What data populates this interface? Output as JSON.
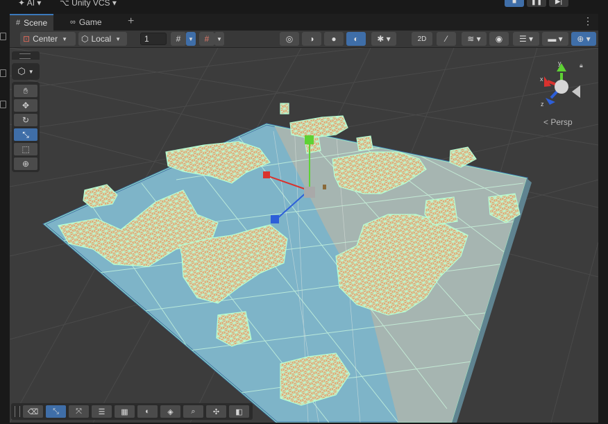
{
  "menubar": {
    "ai_label": "AI",
    "vcs_label": "Unity VCS"
  },
  "play_controls": {
    "play_icon": "stop-icon",
    "pause_icon": "pause-icon",
    "step_icon": "step-icon"
  },
  "tabs": [
    {
      "label": "Scene",
      "icon": "grid-icon",
      "active": true
    },
    {
      "label": "Game",
      "icon": "gamepad-icon",
      "active": false
    }
  ],
  "toolbar": {
    "pivot_mode": "Center",
    "pivot_rotation": "Local",
    "snap_increment": "1"
  },
  "tools": [
    {
      "name": "view-tool",
      "icon": "hand-icon",
      "active": false
    },
    {
      "name": "move-tool",
      "icon": "move-icon",
      "active": false
    },
    {
      "name": "rotate-tool",
      "icon": "rotate-icon",
      "active": false
    },
    {
      "name": "scale-tool",
      "icon": "scale-icon",
      "active": true
    },
    {
      "name": "rect-tool",
      "icon": "rect-icon",
      "active": false
    },
    {
      "name": "transform-tool",
      "icon": "transform-icon",
      "active": false
    }
  ],
  "gizmo": {
    "projection_label": "Persp",
    "axis_y": "y",
    "axis_x": "x",
    "axis_z": "z"
  },
  "colors": {
    "accent": "#3f6ea8",
    "ground": "#7eb4c8",
    "ground_shadow": "#a6b5b1",
    "wire": "#b6ffd4",
    "block": "#e2a873",
    "axis_x": "#d9322e",
    "axis_y": "#5ed234",
    "axis_z": "#2d5fd9"
  }
}
